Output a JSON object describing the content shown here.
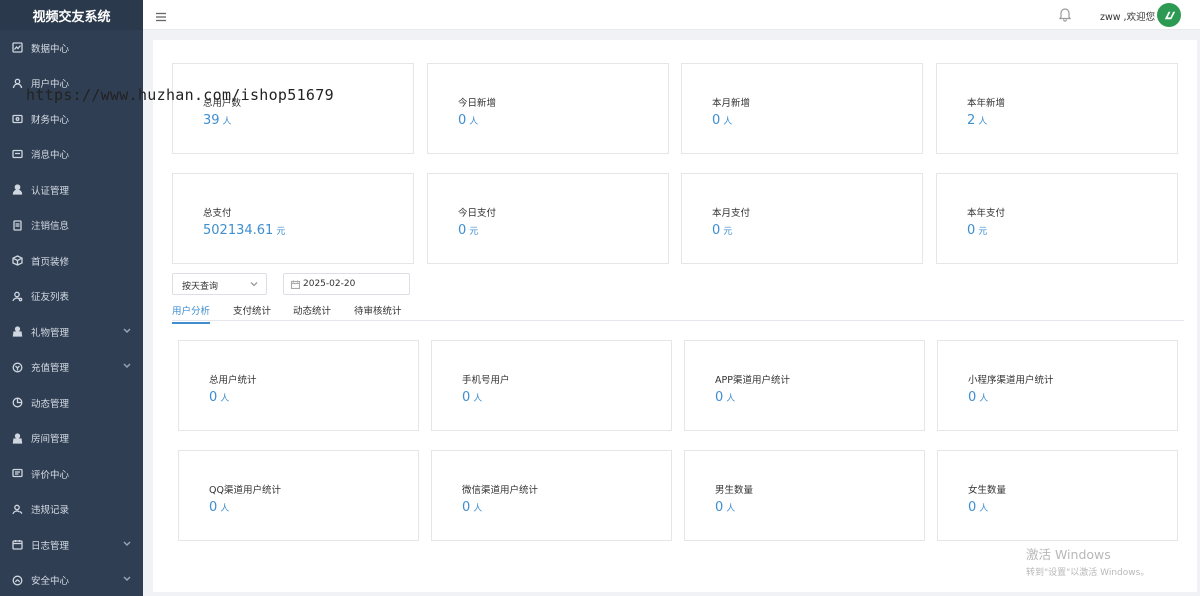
{
  "app": {
    "title": "视频交友系统"
  },
  "sidebar": {
    "items": [
      {
        "label": "数据中心",
        "icon": "chart-icon",
        "expandable": false
      },
      {
        "label": "用户中心",
        "icon": "user-icon",
        "expandable": false
      },
      {
        "label": "财务中心",
        "icon": "wallet-icon",
        "expandable": false
      },
      {
        "label": "消息中心",
        "icon": "message-icon",
        "expandable": false
      },
      {
        "label": "认证管理",
        "icon": "person-solid-icon",
        "expandable": false
      },
      {
        "label": "注销信息",
        "icon": "document-icon",
        "expandable": false
      },
      {
        "label": "首页装修",
        "icon": "cube-icon",
        "expandable": false
      },
      {
        "label": "征友列表",
        "icon": "user-search-icon",
        "expandable": false
      },
      {
        "label": "礼物管理",
        "icon": "gift-icon",
        "expandable": true
      },
      {
        "label": "充值管理",
        "icon": "recharge-icon",
        "expandable": true
      },
      {
        "label": "动态管理",
        "icon": "pie-icon",
        "expandable": false
      },
      {
        "label": "房间管理",
        "icon": "room-icon",
        "expandable": false
      },
      {
        "label": "评价中心",
        "icon": "comment-icon",
        "expandable": false
      },
      {
        "label": "违规记录",
        "icon": "violation-icon",
        "expandable": false
      },
      {
        "label": "日志管理",
        "icon": "calendar-icon",
        "expandable": true
      },
      {
        "label": "安全中心",
        "icon": "shield-icon",
        "expandable": true
      }
    ]
  },
  "header": {
    "welcome": "zww ,欢迎您",
    "menu_icon": "hamburger-icon",
    "bell_icon": "bell-icon",
    "avatar_icon": "logo-avatar-icon",
    "avatar_color": "#2c9a52"
  },
  "summary_users": [
    {
      "label": "总用户数",
      "value": "39",
      "unit": "人"
    },
    {
      "label": "今日新增",
      "value": "0",
      "unit": "人"
    },
    {
      "label": "本月新增",
      "value": "0",
      "unit": "人"
    },
    {
      "label": "本年新增",
      "value": "2",
      "unit": "人"
    }
  ],
  "summary_payments": [
    {
      "label": "总支付",
      "value": "502134.61",
      "unit": "元"
    },
    {
      "label": "今日支付",
      "value": "0",
      "unit": "元"
    },
    {
      "label": "本月支付",
      "value": "0",
      "unit": "元"
    },
    {
      "label": "本年支付",
      "value": "0",
      "unit": "元"
    }
  ],
  "filters": {
    "query_mode": "按天查询",
    "date": "2025-02-20"
  },
  "tabs": [
    {
      "label": "用户分析",
      "active": true
    },
    {
      "label": "支付统计",
      "active": false
    },
    {
      "label": "动态统计",
      "active": false
    },
    {
      "label": "待审核统计",
      "active": false
    }
  ],
  "user_analysis": [
    {
      "label": "总用户统计",
      "value": "0",
      "unit": "人"
    },
    {
      "label": "手机号用户",
      "value": "0",
      "unit": "人"
    },
    {
      "label": "APP渠道用户统计",
      "value": "0",
      "unit": "人"
    },
    {
      "label": "小程序渠道用户统计",
      "value": "0",
      "unit": "人"
    },
    {
      "label": "QQ渠道用户统计",
      "value": "0",
      "unit": "人"
    },
    {
      "label": "微信渠道用户统计",
      "value": "0",
      "unit": "人"
    },
    {
      "label": "男生数量",
      "value": "0",
      "unit": "人"
    },
    {
      "label": "女生数量",
      "value": "0",
      "unit": "人"
    }
  ],
  "overlay": {
    "watermark": "https://www.huzhan.com/ishop51679",
    "windows_line1": "激活 Windows",
    "windows_line2": "转到\"设置\"以激活 Windows。"
  },
  "colors": {
    "accent": "#3e8ed0",
    "sidebar_bg": "#2f3e52"
  }
}
